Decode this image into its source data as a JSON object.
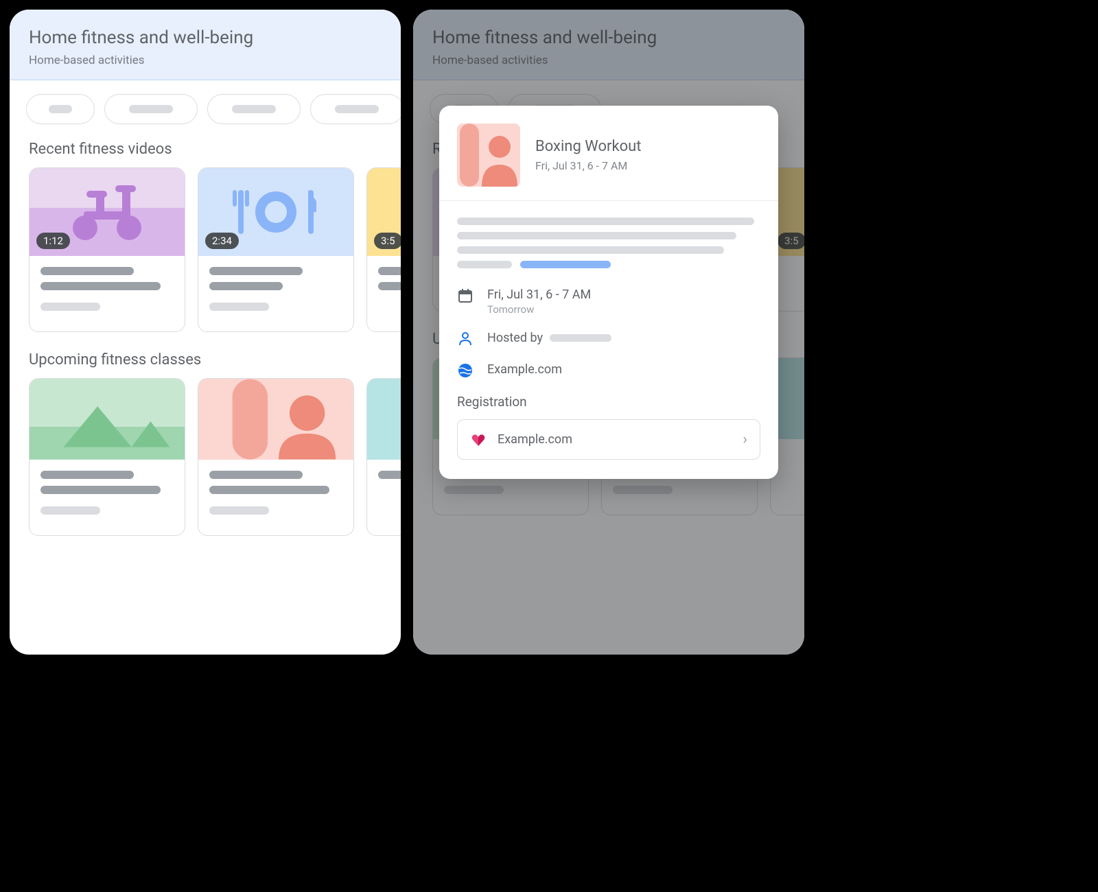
{
  "header": {
    "title": "Home fitness and well-being",
    "subtitle": "Home-based activities"
  },
  "sections": {
    "videos_title": "Recent fitness videos",
    "classes_title": "Upcoming fitness classes"
  },
  "videos": [
    {
      "duration": "1:12"
    },
    {
      "duration": "2:34"
    },
    {
      "duration": "3:5"
    }
  ],
  "modal": {
    "title": "Boxing Workout",
    "subtitle": "Fri, Jul 31, 6 - 7 AM",
    "when": "Fri, Jul 31, 6 - 7 AM",
    "when_rel": "Tomorrow",
    "hosted_by_label": "Hosted by",
    "site": "Example.com",
    "registration_label": "Registration",
    "registration_site": "Example.com"
  }
}
